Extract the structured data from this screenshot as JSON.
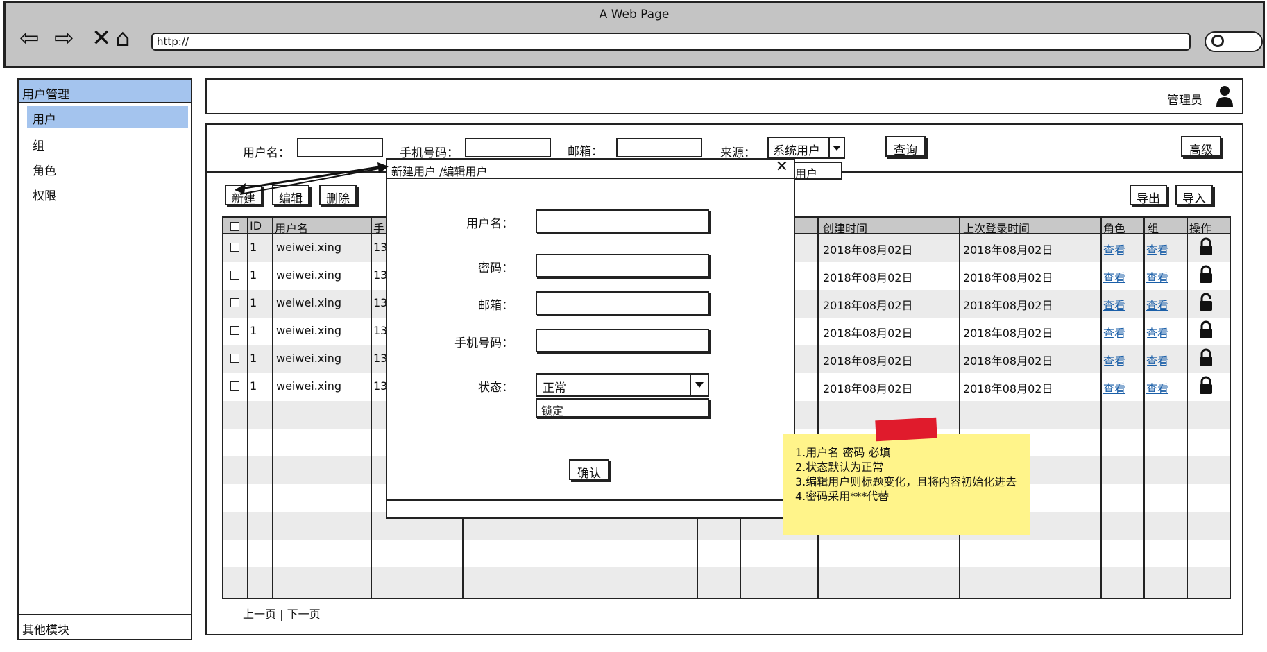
{
  "window": {
    "title": "A Web Page",
    "url": "http://"
  },
  "sidebar": {
    "header": "用户管理",
    "items": [
      {
        "label": "用户"
      },
      {
        "label": "组"
      },
      {
        "label": "角色"
      },
      {
        "label": "权限"
      }
    ],
    "footer": "其他模块"
  },
  "header": {
    "admin_label": "管理员"
  },
  "filters": {
    "username_label": "用户名：",
    "phone_label": "手机号码：",
    "email_label": "邮箱：",
    "source_label": "来源：",
    "source_value": "系统用户",
    "source_popup_option": "用户",
    "query_button": "查询",
    "advanced_button": "高级"
  },
  "toolbar": {
    "new_button": "新建",
    "edit_button": "编辑",
    "delete_button": "删除",
    "export_button": "导出",
    "import_button": "导入"
  },
  "table": {
    "columns": [
      "ID",
      "用户名",
      "手",
      "创建时间",
      "上次登录时间",
      "角色",
      "组",
      "操作"
    ],
    "rows": [
      {
        "id": "1",
        "username": "weiwei.xing",
        "phone": "13",
        "created": "2018年08月02日",
        "last_login": "2018年08月02日",
        "role_link": "查看",
        "group_link": "查看",
        "lock": "locked"
      },
      {
        "id": "1",
        "username": "weiwei.xing",
        "phone": "13",
        "created": "2018年08月02日",
        "last_login": "2018年08月02日",
        "role_link": "查看",
        "group_link": "查看",
        "lock": "locked"
      },
      {
        "id": "1",
        "username": "weiwei.xing",
        "phone": "13",
        "created": "2018年08月02日",
        "last_login": "2018年08月02日",
        "role_link": "查看",
        "group_link": "查看",
        "lock": "unlocked"
      },
      {
        "id": "1",
        "username": "weiwei.xing",
        "phone": "13",
        "created": "2018年08月02日",
        "last_login": "2018年08月02日",
        "role_link": "查看",
        "group_link": "查看",
        "lock": "locked"
      },
      {
        "id": "1",
        "username": "weiwei.xing",
        "phone": "13",
        "created": "2018年08月02日",
        "last_login": "2018年08月02日",
        "role_link": "查看",
        "group_link": "查看",
        "lock": "locked"
      },
      {
        "id": "1",
        "username": "weiwei.xing",
        "phone": "13",
        "created": "2018年08月02日",
        "last_login": "2018年08月02日",
        "role_link": "查看",
        "group_link": "查看",
        "lock": "locked"
      }
    ],
    "pager": "上一页 | 下一页"
  },
  "dialog": {
    "title": "新建用户 /编辑用户",
    "username_label": "用户名：",
    "password_label": "密码：",
    "email_label": "邮箱：",
    "phone_label": "手机号码：",
    "status_label": "状态：",
    "status_value": "正常",
    "status_option": "锁定",
    "confirm_button": "确认"
  },
  "note": {
    "lines": [
      "1.用户名 密码 必填",
      "2.状态默认为正常",
      "3.编辑用户则标题变化，且将内容初始化进去",
      "4.密码采用***代替"
    ]
  },
  "colors": {
    "chrome_bg": "#c4c4c4",
    "selection_blue": "#a4c4ee",
    "table_header": "#c8c8c8",
    "stripe": "#ebebeb",
    "link": "#1b5fa8",
    "sticky": "#fff48a",
    "tape": "#e01b2c"
  }
}
